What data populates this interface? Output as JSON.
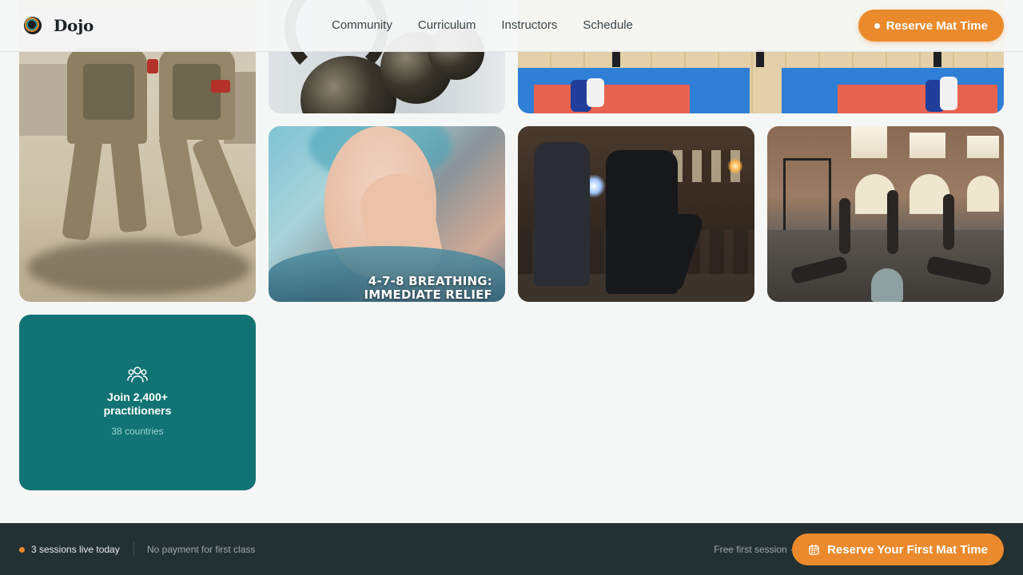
{
  "header": {
    "brand": "Dojo",
    "nav": [
      "Community",
      "Curriculum",
      "Instructors",
      "Schedule"
    ],
    "cta_label": "Reserve Mat Time"
  },
  "gallery": {
    "breathing_caption_line1": "4-7-8 BREATHING:",
    "breathing_caption_line2": "IMMEDIATE RELIEF"
  },
  "community_card": {
    "title": "Join 2,400+ practitioners",
    "subtitle": "38 countries",
    "icon": "users-icon"
  },
  "footer": {
    "live_status": "3 sessions live today",
    "no_payment": "No payment for first class",
    "free_note": "Free first session ·",
    "cta_label": "Reserve Your First Mat Time"
  },
  "colors": {
    "accent": "#ea8a2c",
    "teal": "#117373",
    "footer_bg": "#243133",
    "page_bg": "#f5f7f6"
  }
}
